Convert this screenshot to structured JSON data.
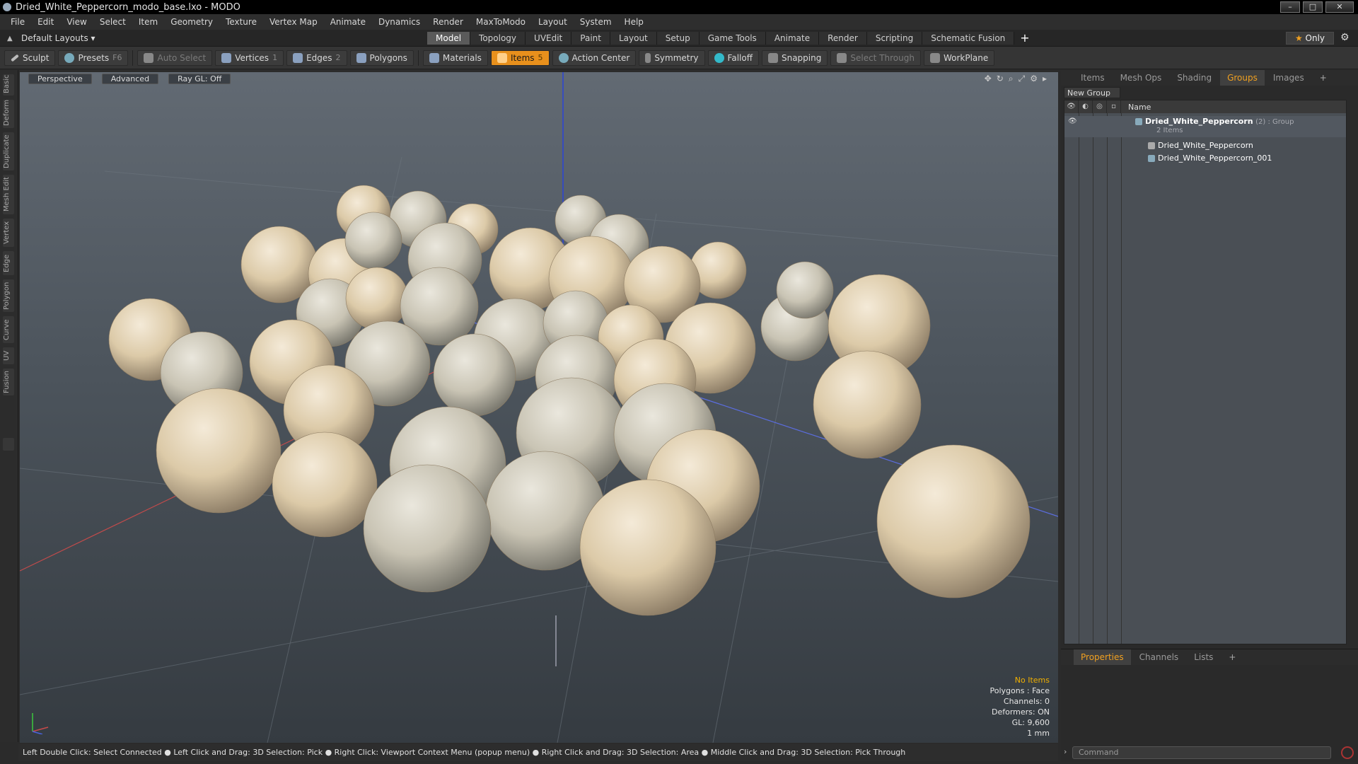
{
  "window": {
    "title": "Dried_White_Peppercorn_modo_base.lxo - MODO",
    "buttons": [
      "–",
      "□",
      "✕"
    ]
  },
  "menu": [
    "File",
    "Edit",
    "View",
    "Select",
    "Item",
    "Geometry",
    "Texture",
    "Vertex Map",
    "Animate",
    "Dynamics",
    "Render",
    "MaxToModo",
    "Layout",
    "System",
    "Help"
  ],
  "layouts": {
    "label": "Default Layouts ▾",
    "tabs": [
      "Model",
      "Topology",
      "UVEdit",
      "Paint",
      "Layout",
      "Setup",
      "Game Tools",
      "Animate",
      "Render",
      "Scripting",
      "Schematic Fusion"
    ],
    "active_tab": "Model",
    "only_label": "Only"
  },
  "toolbar": {
    "sculpt": "Sculpt",
    "presets": "Presets",
    "presets_key": "F6",
    "auto_select": "Auto Select",
    "vertices": "Vertices",
    "vertices_count": "1",
    "edges": "Edges",
    "edges_count": "2",
    "polygons": "Polygons",
    "materials": "Materials",
    "items": "Items",
    "items_count": "5",
    "action_center": "Action Center",
    "symmetry": "Symmetry",
    "falloff": "Falloff",
    "snapping": "Snapping",
    "select_through": "Select Through",
    "workplane": "WorkPlane"
  },
  "left_tabs": [
    "Basic",
    "Deform",
    "Duplicate",
    "Mesh Edit",
    "Vertex",
    "Edge",
    "Polygon",
    "Curve",
    "UV",
    "Fusion"
  ],
  "viewport": {
    "view": "Perspective",
    "mode": "Advanced",
    "raygl": "Ray GL: Off",
    "hud": {
      "selection": "No Items",
      "polygons": "Polygons : Face",
      "channels": "Channels: 0",
      "deformers": "Deformers: ON",
      "gl": "GL: 9,600",
      "unit": "1 mm"
    }
  },
  "right_panel": {
    "tabs": [
      "Items",
      "Mesh Ops",
      "Shading",
      "Groups",
      "Images",
      "+"
    ],
    "active_tab": "Groups",
    "new_group": "New Group",
    "name_header": "Name",
    "group": {
      "name": "Dried_White_Peppercorn",
      "meta": "(2) : Group",
      "count": "2 Items",
      "children": [
        "Dried_White_Peppercorn",
        "Dried_White_Peppercorn_001"
      ]
    }
  },
  "props_panel": {
    "tabs": [
      "Properties",
      "Channels",
      "Lists",
      "+"
    ],
    "active_tab": "Properties",
    "command_placeholder": "Command"
  },
  "status": "Left Double Click: Select Connected ● Left Click and Drag: 3D Selection: Pick ● Right Click: Viewport Context Menu (popup menu) ● Right Click and Drag: 3D Selection: Area ● Middle Click and Drag: 3D Selection: Pick Through",
  "colors": {
    "accent": "#e8901c",
    "viewport_top": "#626a73",
    "viewport_bottom": "#353b41",
    "peppercorn": "#e2d2b5"
  }
}
